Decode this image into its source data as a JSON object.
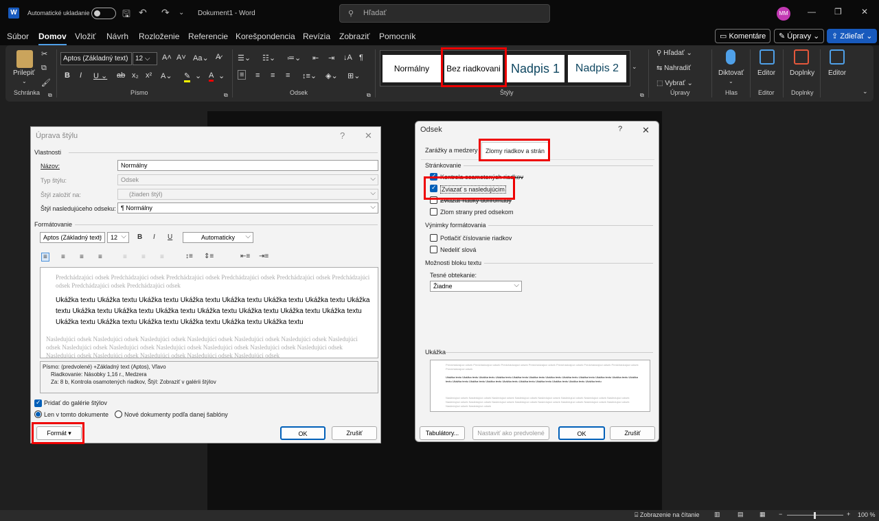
{
  "titlebar": {
    "autosave_label": "Automatické ukladanie",
    "doc_title": "Dokument1 - Word",
    "search_placeholder": "Hľadať",
    "avatar": "MM"
  },
  "menu": {
    "items": [
      "Súbor",
      "Domov",
      "Vložiť",
      "Návrh",
      "Rozloženie",
      "Referencie",
      "Korešpondencia",
      "Revízia",
      "Zobraziť",
      "Pomocník"
    ],
    "active": "Domov",
    "comments": "Komentáre",
    "edit": "Úpravy",
    "share": "Zdieľať"
  },
  "ribbon": {
    "paste": "Prilepiť",
    "font_name": "Aptos (Základný text)",
    "font_size": "12",
    "groups": {
      "clipboard": "Schránka",
      "font": "Písmo",
      "paragraph": "Odsek",
      "styles": "Štýly",
      "editing": "Úpravy",
      "voice": "Hlas",
      "editor": "Editor",
      "addins": "Doplnky"
    },
    "styles": [
      "Normálny",
      "Bez riadkovani",
      "Nadpis 1",
      "Nadpis 2"
    ],
    "find": "Hľadať",
    "replace": "Nahradiť",
    "select": "Vybrať",
    "dictate": "Diktovať",
    "editor": "Editor",
    "addins": "Doplnky",
    "editor2": "Editor"
  },
  "status": {
    "reading": "Zobrazenie na čítanie",
    "zoom": "100 %"
  },
  "style_dialog": {
    "title": "Úprava štýlu",
    "properties": "Vlastnosti",
    "name_label": "Názov:",
    "name_value": "Normálny",
    "type_label": "Typ štýlu:",
    "type_value": "Odsek",
    "based_label": "Štýl založiť na:",
    "based_value": "(žiaden štýl)",
    "next_label": "Štýl nasledujúceho odseku:",
    "next_value": "¶ Normálny",
    "formatting": "Formátovanie",
    "font": "Aptos (Základný text)",
    "size": "12",
    "color": "Automaticky",
    "prev_text": "Predchádzajúci odsek Predchádzajúci odsek Predchádzajúci odsek Predchádzajúci odsek Predchádzajúci odsek Predchádzajúci odsek Predchádzajúci odsek Predchádzajúci odsek",
    "sample_text": "Ukážka textu Ukážka textu Ukážka textu Ukážka textu Ukážka textu Ukážka textu Ukážka textu Ukážka textu Ukážka textu Ukážka textu Ukážka textu Ukážka textu Ukážka textu Ukážka textu Ukážka textu Ukážka textu Ukážka textu Ukážka textu Ukážka textu Ukážka textu Ukážka textu",
    "next_text": "Nasledujúci odsek Nasledujúci odsek Nasledujúci odsek Nasledujúci odsek Nasledujúci odsek Nasledujúci odsek Nasledujúci odsek Nasledujúci odsek Nasledujúci odsek Nasledujúci odsek Nasledujúci odsek Nasledujúci odsek Nasledujúci odsek Nasledujúci odsek Nasledujúci odsek Nasledujúci odsek Nasledujúci odsek Nasledujúci odsek",
    "desc_line1": "Písmo: (predvolené) +Základný text (Aptos), Vľavo",
    "desc_line2": "Riadkovanie:  Násobky 1,16 r., Medzera",
    "desc_line3": "Za:  8 b, Kontrola osamotených riadkov, Štýl: Zobraziť v galérii štýlov",
    "add_gallery": "Pridať do galérie štýlov",
    "only_doc": "Len v tomto dokumente",
    "new_docs": "Nové dokumenty podľa danej šablóny",
    "format_btn": "Formát",
    "ok": "OK",
    "cancel": "Zrušiť"
  },
  "para_dialog": {
    "title": "Odsek",
    "tab1": "Zarážky a medzery",
    "tab2": "Zlomy riadkov a strán",
    "pagination": "Stránkovanie",
    "widow": "Kontrola osamotených riadkov",
    "keep_next": "Zviazať s nasledujúcim",
    "keep_lines": "Zviazať riadky dohromady",
    "page_break": "Zlom strany pred odsekom",
    "exceptions": "Výnimky formátovania",
    "suppress": "Potlačiť číslovanie riadkov",
    "no_hyph": "Nedeliť slová",
    "textbox": "Možnosti bloku textu",
    "tight_label": "Tesné obtekanie:",
    "tight_value": "Žiadne",
    "preview": "Ukážka",
    "tabs_btn": "Tabulátory...",
    "default_btn": "Nastaviť ako predvolené",
    "ok": "OK",
    "cancel": "Zrušiť"
  }
}
